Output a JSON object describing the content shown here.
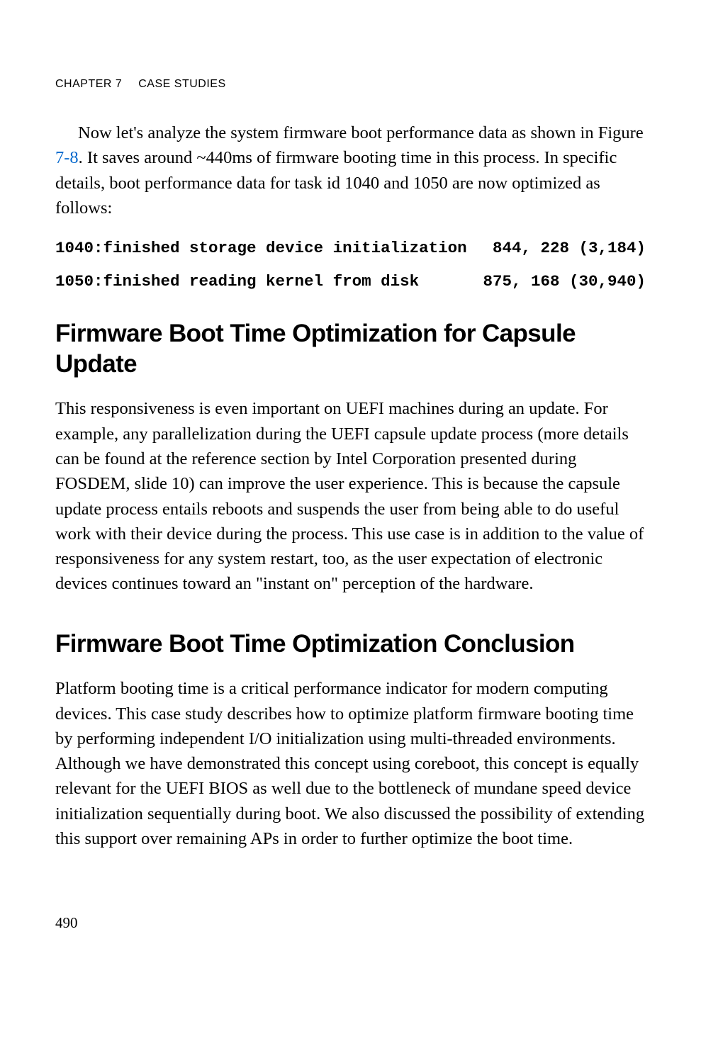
{
  "header": {
    "chapter": "CHAPTER 7",
    "title": "CASE STUDIES"
  },
  "intro": {
    "text_before_link": "Now let's analyze the system firmware boot performance data as shown in Figure ",
    "link": "7-8",
    "text_after_link": ". It saves around ~440ms of firmware booting time in this process. In specific details, boot performance data for task id 1040 and 1050 are now optimized as follows:"
  },
  "code": {
    "line1_left": "1040:finished storage device initialization",
    "line1_right": "844, 228 (3,184)",
    "line2_left": "1050:finished reading kernel from disk",
    "line2_right": "875, 168 (30,940)"
  },
  "section1": {
    "heading": "Firmware Boot Time Optimization for Capsule Update",
    "body": "This responsiveness is even important on UEFI machines during an update. For example, any parallelization during the UEFI capsule update process (more details can be found at the reference section by Intel Corporation presented during FOSDEM, slide 10) can improve the user experience. This is because the capsule update process entails reboots and suspends the user from being able to do useful work with their device during the process. This use case is in addition to the value of responsiveness for any system restart, too, as the user expectation of electronic devices continues toward an \"instant on\" perception of the hardware."
  },
  "section2": {
    "heading": "Firmware Boot Time Optimization Conclusion",
    "body": "Platform booting time is a critical performance indicator for modern computing devices. This case study describes how to optimize platform firmware booting time by performing independent I/O initialization using multi-threaded environments. Although we have demonstrated this concept using coreboot, this concept is equally relevant for the UEFI BIOS as well due to the bottleneck of mundane speed device initialization sequentially during boot. We also discussed the possibility of extending this support over remaining APs in order to further optimize the boot time."
  },
  "page_number": "490"
}
